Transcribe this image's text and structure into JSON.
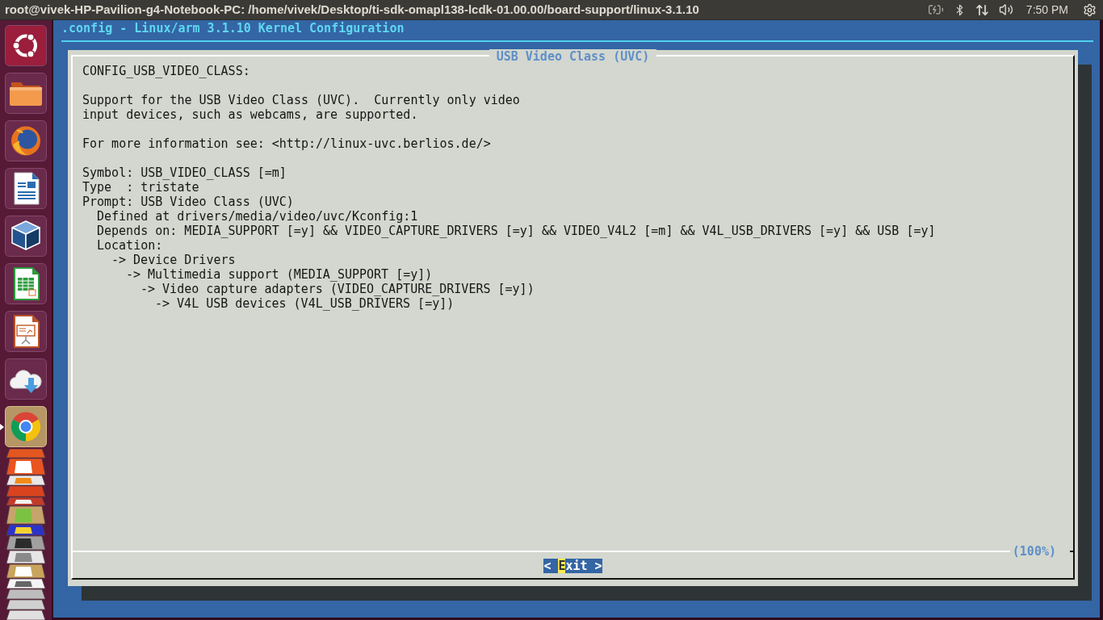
{
  "top_panel": {
    "title": "root@vivek-HP-Pavilion-g4-Notebook-PC: /home/vivek/Desktop/ti-sdk-omapl138-lcdk-01.00.00/board-support/linux-3.1.10",
    "clock": "7:50 PM"
  },
  "launcher": {
    "items": [
      {
        "kind": "ubuntu",
        "selected": false,
        "running": false
      },
      {
        "kind": "files",
        "selected": false,
        "running": false
      },
      {
        "kind": "firefox",
        "selected": false,
        "running": false
      },
      {
        "kind": "writer",
        "selected": false,
        "running": false
      },
      {
        "kind": "virtualbox",
        "selected": false,
        "running": false
      },
      {
        "kind": "calc",
        "selected": false,
        "running": false
      },
      {
        "kind": "impress",
        "selected": false,
        "running": false
      },
      {
        "kind": "cloud",
        "selected": false,
        "running": false
      },
      {
        "kind": "chrome",
        "selected": true,
        "running": true
      }
    ]
  },
  "terminal": {
    "header": ".config - Linux/arm 3.1.10 Kernel Configuration",
    "dialog": {
      "title": "USB Video Class (UVC)",
      "help": [
        {
          "lines": [
            "CONFIG_USB_VIDEO_CLASS:"
          ]
        },
        {
          "lines": [
            "Support for the USB Video Class (UVC).  Currently only video",
            "input devices, such as webcams, are supported."
          ]
        },
        {
          "lines": [
            "For more information see: <http://linux-uvc.berlios.de/>"
          ]
        }
      ],
      "info": [
        {
          "text": "Symbol: USB_VIDEO_CLASS [=m]"
        },
        {
          "text": "Type  : tristate"
        },
        {
          "text": "Prompt: USB Video Class (UVC)",
          "children": [
            {
              "text": "Defined at drivers/media/video/uvc/Kconfig:1"
            },
            {
              "text": "Depends on: MEDIA_SUPPORT [=y] && VIDEO_CAPTURE_DRIVERS [=y] && VIDEO_V4L2 [=m] && V4L_USB_DRIVERS [=y] && USB [=y]"
            },
            {
              "text": "Location:",
              "children": [
                {
                  "text": "-> Device Drivers",
                  "children": [
                    {
                      "text": "-> Multimedia support (MEDIA_SUPPORT [=y])",
                      "children": [
                        {
                          "text": "-> Video capture adapters (VIDEO_CAPTURE_DRIVERS [=y])",
                          "children": [
                            {
                              "text": "-> V4L USB devices (V4L_USB_DRIVERS [=y])"
                            }
                          ]
                        }
                      ]
                    }
                  ]
                }
              ]
            }
          ]
        }
      ],
      "scroll_indicator": "(100%)",
      "buttons": [
        {
          "selected": true,
          "parts": [
            {
              "kind": "plain",
              "text": "< "
            },
            {
              "kind": "hotkey",
              "text": "E"
            },
            {
              "kind": "plain",
              "text": "xit >"
            }
          ]
        }
      ]
    }
  }
}
